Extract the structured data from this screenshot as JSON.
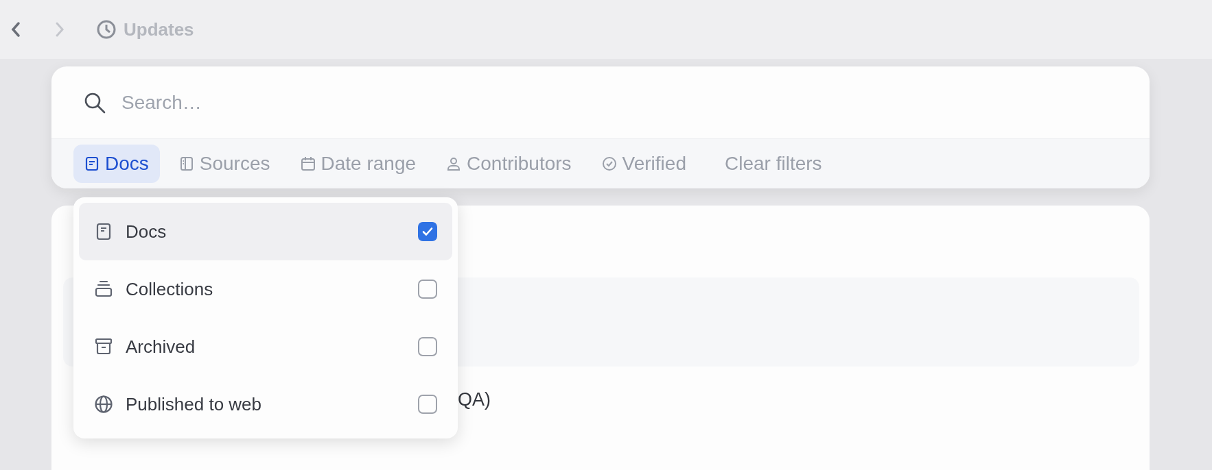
{
  "topbar": {
    "title": "Updates"
  },
  "search": {
    "placeholder": "Search…"
  },
  "filters": [
    {
      "kind": "doc",
      "label": "Docs",
      "selected": true
    },
    {
      "kind": "sources",
      "label": "Sources",
      "selected": false
    },
    {
      "kind": "date",
      "label": "Date range",
      "selected": false
    },
    {
      "kind": "person",
      "label": "Contributors",
      "selected": false
    },
    {
      "kind": "verified",
      "label": "Verified",
      "selected": false
    },
    {
      "kind": "clear",
      "label": "Clear filters",
      "selected": false
    }
  ],
  "dropdown": {
    "options": [
      {
        "kind": "doc",
        "label": "Docs",
        "checked": true,
        "selected": true
      },
      {
        "kind": "collections",
        "label": "Collections",
        "checked": false,
        "selected": false
      },
      {
        "kind": "archive",
        "label": "Archived",
        "checked": false,
        "selected": false
      },
      {
        "kind": "globe",
        "label": "Published to web",
        "checked": false,
        "selected": false
      }
    ]
  },
  "background_list": {
    "item_title": "QA)"
  }
}
